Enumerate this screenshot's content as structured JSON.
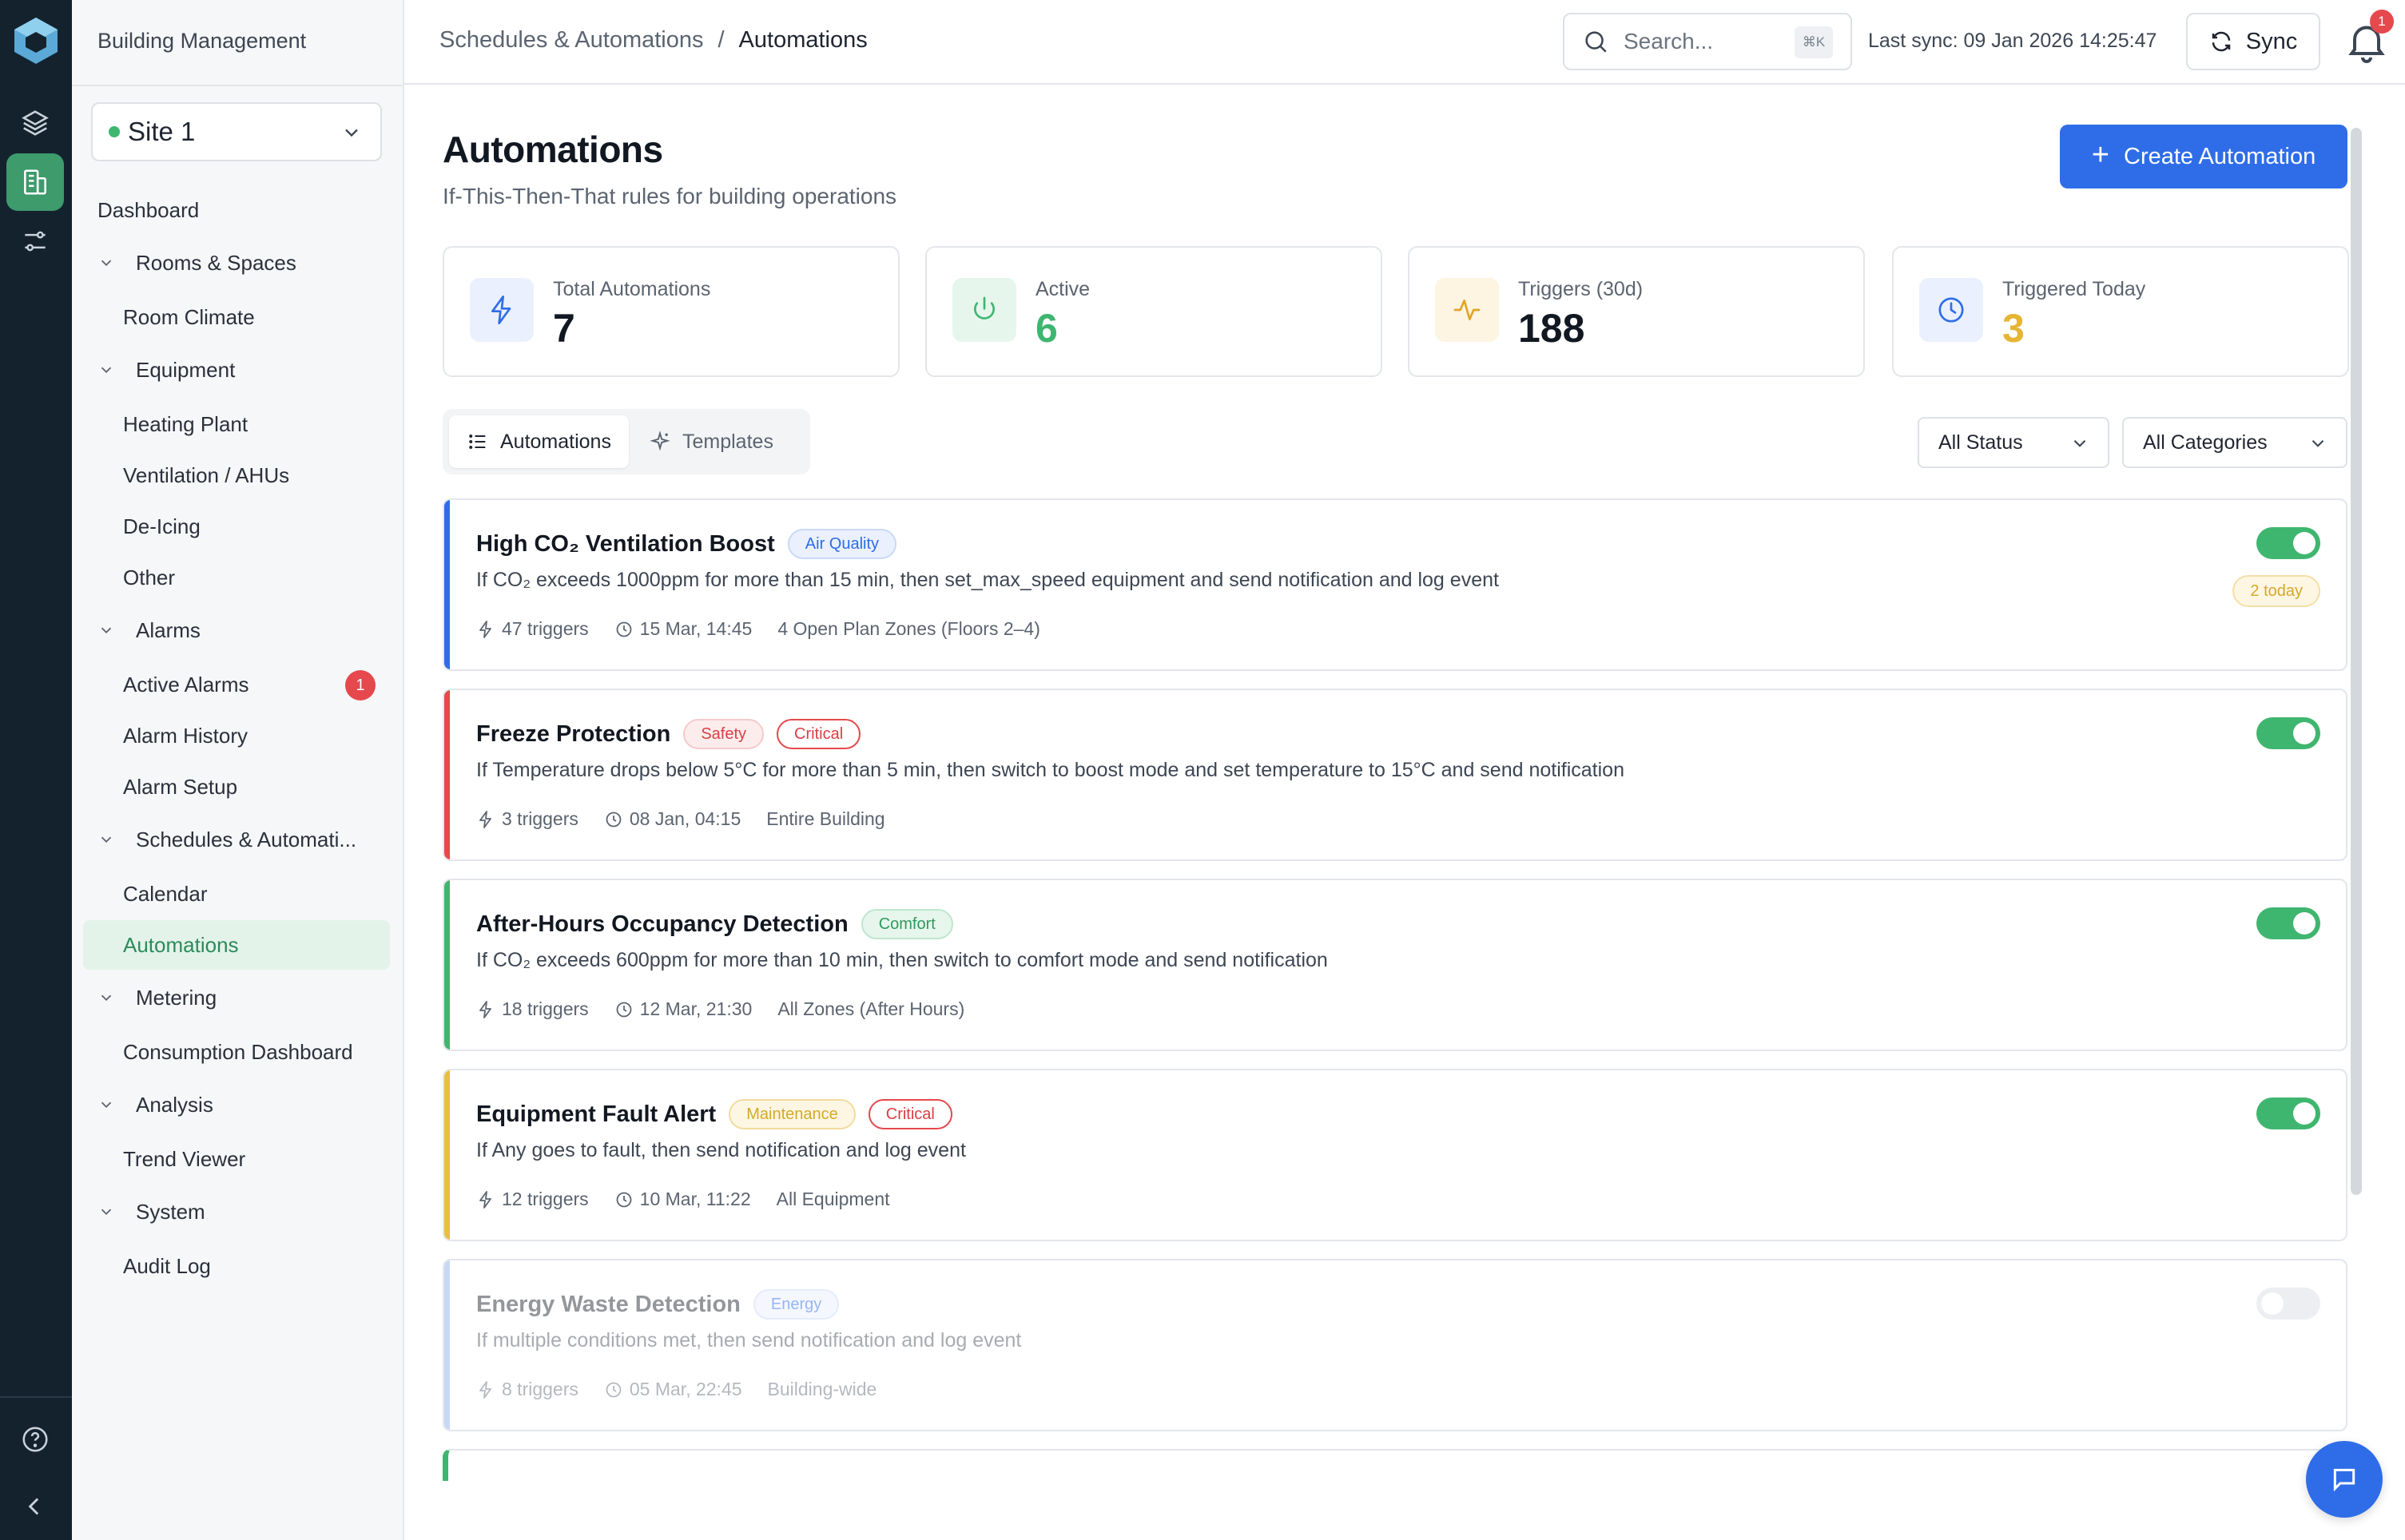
{
  "app": {
    "name": "Building Management"
  },
  "site": {
    "selected": "Site 1",
    "status_color": "#3fb66f"
  },
  "nav": {
    "items": [
      {
        "label": "Dashboard",
        "kind": "top"
      },
      {
        "label": "Rooms & Spaces",
        "kind": "group"
      },
      {
        "label": "Room Climate",
        "kind": "child"
      },
      {
        "label": "Equipment",
        "kind": "group"
      },
      {
        "label": "Heating Plant",
        "kind": "child"
      },
      {
        "label": "Ventilation / AHUs",
        "kind": "child"
      },
      {
        "label": "De-Icing",
        "kind": "child"
      },
      {
        "label": "Other",
        "kind": "child"
      },
      {
        "label": "Alarms",
        "kind": "group"
      },
      {
        "label": "Active Alarms",
        "kind": "child",
        "badge": "1"
      },
      {
        "label": "Alarm History",
        "kind": "child"
      },
      {
        "label": "Alarm Setup",
        "kind": "child"
      },
      {
        "label": "Schedules & Automati...",
        "kind": "group"
      },
      {
        "label": "Calendar",
        "kind": "child"
      },
      {
        "label": "Automations",
        "kind": "child",
        "active": true
      },
      {
        "label": "Metering",
        "kind": "group"
      },
      {
        "label": "Consumption Dashboard",
        "kind": "child"
      },
      {
        "label": "Analysis",
        "kind": "group"
      },
      {
        "label": "Trend Viewer",
        "kind": "child"
      },
      {
        "label": "System",
        "kind": "group"
      },
      {
        "label": "Audit Log",
        "kind": "child"
      }
    ]
  },
  "header": {
    "breadcrumb": [
      "Schedules & Automations",
      "/",
      "Automations"
    ],
    "search_placeholder": "Search...",
    "search_shortcut": "⌘K",
    "last_sync": "Last sync: 09 Jan 2026 14:25:47",
    "sync_label": "Sync",
    "notification_count": "1"
  },
  "page": {
    "title": "Automations",
    "subtitle": "If-This-Then-That rules for building operations",
    "create_label": "Create Automation"
  },
  "stats": [
    {
      "label": "Total Automations",
      "value": "7",
      "color": "#121821",
      "icon": "bolt-icon",
      "icon_bg": "#eaf0fd",
      "icon_color": "#2f6de8"
    },
    {
      "label": "Active",
      "value": "6",
      "color": "#3fb66f",
      "icon": "power-icon",
      "icon_bg": "#e6f6ec",
      "icon_color": "#3fb66f"
    },
    {
      "label": "Triggers (30d)",
      "value": "188",
      "color": "#121821",
      "icon": "activity-icon",
      "icon_bg": "#fdf4e1",
      "icon_color": "#e0a526"
    },
    {
      "label": "Triggered Today",
      "value": "3",
      "color": "#e6b534",
      "icon": "clock-icon",
      "icon_bg": "#eaf0fd",
      "icon_color": "#2f6de8"
    }
  ],
  "tabs": [
    {
      "label": "Automations",
      "active": true,
      "icon": "list-icon"
    },
    {
      "label": "Templates",
      "active": false,
      "icon": "sparkle-icon"
    }
  ],
  "filters": {
    "status": "All Status",
    "category": "All Categories"
  },
  "automations": [
    {
      "title": "High CO₂ Ventilation Boost",
      "accent": "#2f6de8",
      "tags": [
        {
          "label": "Air Quality",
          "bg": "#eaf0fd",
          "border": "#c9d8f7",
          "color": "#2f6de8"
        }
      ],
      "description": "If CO₂ exceeds 1000ppm for more than 15 min, then set_max_speed equipment and send notification and log event",
      "triggers": "47 triggers",
      "last": "15 Mar, 14:45",
      "scope": "4 Open Plan Zones (Floors 2–4)",
      "enabled": true,
      "today": "2 today"
    },
    {
      "title": "Freeze Protection",
      "accent": "#e5484d",
      "tags": [
        {
          "label": "Safety",
          "bg": "#fdecec",
          "border": "#f6caca",
          "color": "#d93f44"
        },
        {
          "label": "Critical",
          "bg": "#ffffff",
          "border": "#e5484d",
          "color": "#d93f44"
        }
      ],
      "description": "If Temperature drops below 5°C for more than 5 min, then switch to boost mode and set temperature to 15°C and send notification",
      "triggers": "3 triggers",
      "last": "08 Jan, 04:15",
      "scope": "Entire Building",
      "enabled": true
    },
    {
      "title": "After-Hours Occupancy Detection",
      "accent": "#3fb66f",
      "tags": [
        {
          "label": "Comfort",
          "bg": "#e6f6ec",
          "border": "#bfe6cd",
          "color": "#2f9a5c"
        }
      ],
      "description": "If CO₂ exceeds 600ppm for more than 10 min, then switch to comfort mode and send notification",
      "triggers": "18 triggers",
      "last": "12 Mar, 21:30",
      "scope": "All Zones (After Hours)",
      "enabled": true
    },
    {
      "title": "Equipment Fault Alert",
      "accent": "#e8c040",
      "tags": [
        {
          "label": "Maintenance",
          "bg": "#fdf6e3",
          "border": "#f1dc9e",
          "color": "#d4a92a"
        },
        {
          "label": "Critical",
          "bg": "#ffffff",
          "border": "#e5484d",
          "color": "#d93f44"
        }
      ],
      "description": "If Any goes to fault, then send notification and log event",
      "triggers": "12 triggers",
      "last": "10 Mar, 11:22",
      "scope": "All Equipment",
      "enabled": true
    },
    {
      "title": "Energy Waste Detection",
      "accent": "#c8d8f4",
      "tags": [
        {
          "label": "Energy",
          "bg": "#eaf0fd",
          "border": "#c9d8f7",
          "color": "#2f6de8"
        }
      ],
      "description": "If multiple conditions met, then send notification and log event",
      "triggers": "8 triggers",
      "last": "05 Mar, 22:45",
      "scope": "Building-wide",
      "enabled": false
    }
  ]
}
